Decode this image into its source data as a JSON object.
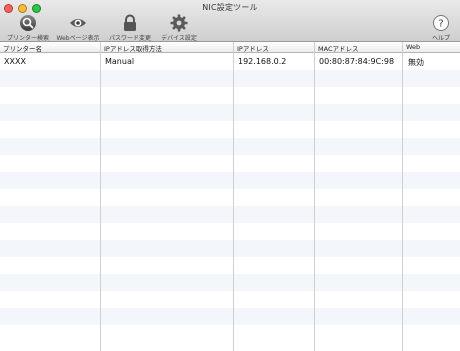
{
  "window": {
    "title": "NIC設定ツール"
  },
  "toolbar": {
    "printer_search": "プリンター検索",
    "web_page": "Webページ表示",
    "password_change": "パスワード変更",
    "device_settings": "デバイス設定",
    "help": "ヘルプ"
  },
  "table": {
    "columns": [
      "プリンター名",
      "IPアドレス取得方法",
      "IPアドレス",
      "MACアドレス",
      "Web"
    ],
    "rows": [
      [
        "XXXX",
        "Manual",
        "192.168.0.2",
        "00:80:87:84:9C:98",
        "無効"
      ]
    ]
  },
  "colors": {
    "toolbar_bg": "#d8d8d8",
    "row_alt": "#f3f6fa"
  }
}
